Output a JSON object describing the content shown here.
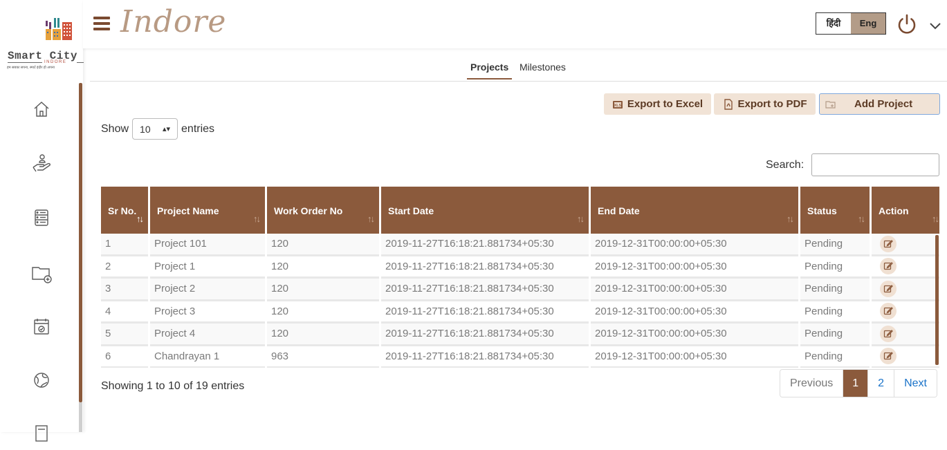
{
  "logo": {
    "title": "Smart City",
    "subtitle": "INDORE",
    "tagline": "हम सबका सपना, स्मार्ट इंदौर हो अपना"
  },
  "header": {
    "brand": "Indore",
    "lang_hindi": "हिंदी",
    "lang_english": "Eng"
  },
  "sidebar": {
    "icons": [
      "home-icon",
      "hand-donate-icon",
      "database-icon",
      "folder-add-icon",
      "calendar-check-icon",
      "globe-hand-icon",
      "document-icon"
    ]
  },
  "tabs": {
    "projects": "Projects",
    "milestones": "Milestones"
  },
  "actions": {
    "export_excel": "Export to Excel",
    "export_pdf": "Export to PDF",
    "add_project": "Add Project"
  },
  "length": {
    "show": "Show",
    "value": "10",
    "entries": "entries"
  },
  "search": {
    "label": "Search:",
    "value": ""
  },
  "table": {
    "headers": [
      "Sr No.",
      "Project Name",
      "Work Order No",
      "Start Date",
      "End Date",
      "Status",
      "Action"
    ],
    "rows": [
      [
        "1",
        "Project 101",
        "120",
        "2019-11-27T16:18:21.881734+05:30",
        "2019-12-31T00:00:00+05:30",
        "Pending"
      ],
      [
        "2",
        "Project 1",
        "120",
        "2019-11-27T16:18:21.881734+05:30",
        "2019-12-31T00:00:00+05:30",
        "Pending"
      ],
      [
        "3",
        "Project 2",
        "120",
        "2019-11-27T16:18:21.881734+05:30",
        "2019-12-31T00:00:00+05:30",
        "Pending"
      ],
      [
        "4",
        "Project 3",
        "120",
        "2019-11-27T16:18:21.881734+05:30",
        "2019-12-31T00:00:00+05:30",
        "Pending"
      ],
      [
        "5",
        "Project 4",
        "120",
        "2019-11-27T16:18:21.881734+05:30",
        "2019-12-31T00:00:00+05:30",
        "Pending"
      ],
      [
        "6",
        "Chandrayan 1",
        "963",
        "2019-11-27T16:18:21.881734+05:30",
        "2019-12-31T00:00:00+05:30",
        "Pending"
      ]
    ]
  },
  "footer": {
    "info": "Showing 1 to 10 of 19 entries",
    "previous": "Previous",
    "page1": "1",
    "page2": "2",
    "next": "Next"
  },
  "colors": {
    "primary": "#8b5a3c",
    "button_bg": "#f1e3d6",
    "lang_active": "#b39c88",
    "brand_text": "#b89a83",
    "link": "#1a73c9"
  }
}
